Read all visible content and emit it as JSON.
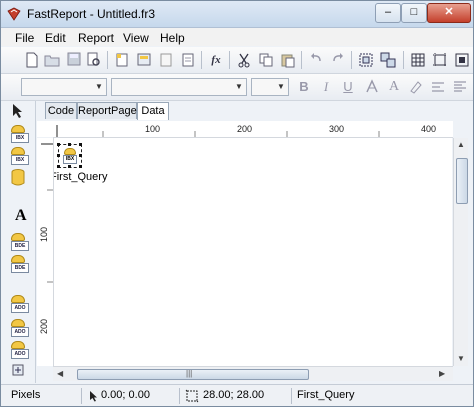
{
  "window": {
    "title": "FastReport - Untitled.fr3",
    "controls": {
      "minimize": "–",
      "maximize": "□",
      "close": "✕"
    }
  },
  "menu": [
    {
      "label": "File"
    },
    {
      "label": "Edit"
    },
    {
      "label": "Report"
    },
    {
      "label": "View"
    },
    {
      "label": "Help"
    }
  ],
  "toolbar_format": {
    "bold": "B",
    "italic": "I",
    "underline": "U"
  },
  "component_palette": [
    {
      "name": "select-tool",
      "label": ""
    },
    {
      "name": "ibx-table",
      "label": "IBX"
    },
    {
      "name": "ibx-query",
      "label": "IBX"
    },
    {
      "name": "database",
      "label": ""
    },
    {
      "name": "text-object",
      "label": "A"
    },
    {
      "name": "bde-table",
      "label": "BDE"
    },
    {
      "name": "bde-query",
      "label": "BDE"
    },
    {
      "name": "ado-table",
      "label": "ADO"
    },
    {
      "name": "ado-query",
      "label": "ADO"
    },
    {
      "name": "ado-database",
      "label": "ADO"
    }
  ],
  "tabs": [
    {
      "label": "Code"
    },
    {
      "label": "ReportPage"
    },
    {
      "label": "Data",
      "active": true
    }
  ],
  "ruler": {
    "h_marks": [
      "100",
      "200",
      "300",
      "400"
    ],
    "v_marks": [
      "100",
      "200"
    ]
  },
  "canvas": {
    "component_badge": "IBX",
    "component_label": "First_Query"
  },
  "status": {
    "units": "Pixels",
    "position": "0.00; 0.00",
    "size": "28.00; 28.00",
    "selected": "First_Query"
  },
  "colors": {
    "accent": "#c4402c",
    "db_gold": "#f2c744"
  }
}
